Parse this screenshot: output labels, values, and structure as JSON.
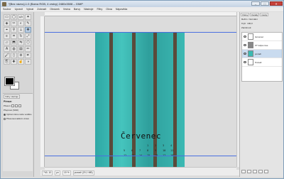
{
  "window": {
    "title": "*[Bez názvu]-1.0 (Barva RGB, 4 vrstvy) 2480x3508 – GIMP",
    "buttons": {
      "minimize": "–",
      "maximize": "□",
      "close": "✕"
    }
  },
  "menubar": [
    "Soubor",
    "Upravit",
    "Vybrat",
    "Zobrazit",
    "Obrázek",
    "Vrstva",
    "Barvy",
    "Nástroje",
    "Filtry",
    "Okna",
    "Nápověda"
  ],
  "toolbox": {
    "tools": [
      "rect-select-icon",
      "ellipse-select-icon",
      "lasso-icon",
      "fuzzy-select-icon",
      "color-select-icon",
      "scissors-icon",
      "foreground-select-icon",
      "paths-icon",
      "color-picker-icon",
      "zoom-icon",
      "measure-icon",
      "move-icon",
      "align-icon",
      "crop-icon",
      "rotate-icon",
      "scale-icon",
      "shear-icon",
      "perspective-icon",
      "flip-icon",
      "cage-icon",
      "text-icon",
      "bucket-fill-icon",
      "blend-icon",
      "pencil-icon",
      "paintbrush-icon",
      "eraser-icon",
      "airbrush-icon",
      "ink-icon",
      "clone-icon",
      "heal-icon",
      "smudge-icon",
      "dodge-icon"
    ],
    "active_tool_index": 11,
    "colors": {
      "foreground": "#000000",
      "background": "#ffffff"
    }
  },
  "tool_options": {
    "tabs": [
      "Volby nástroje"
    ],
    "title": "Přesun",
    "move_label": "Přesun:",
    "toggle_label": "Přepnout (Shift)",
    "options": [
      "Vybrat vrstvu nebo vodítko",
      "Přesunout aktivní vrstvu"
    ],
    "selected_option": 0
  },
  "canvas": {
    "month": "Červenec",
    "calendar_rows": [
      [
        "",
        "",
        "",
        "1",
        "2",
        "3",
        "4"
      ],
      [
        "5",
        "6",
        "7",
        "8",
        "9",
        "10",
        "11"
      ],
      [
        "12",
        "13",
        "14",
        "15",
        "16",
        "17",
        "18"
      ]
    ],
    "colors": {
      "wood_dark": "#5a4a3a",
      "teal": "#2ea8a5",
      "guide": "#4a6fe0"
    }
  },
  "statusbar": {
    "coords": "740, 10",
    "unit": "px",
    "zoom": "15 %",
    "info": "pozadí (20,1 MB)"
  },
  "dock": {
    "tabs": [
      "Vrstvy",
      "Kanály",
      "Cesty"
    ],
    "mode_label": "Režim",
    "mode_value": "Normální",
    "opacity_label": "Krytí",
    "opacity_value": "100,0",
    "lock_label": "Zamknout:",
    "layers": [
      {
        "name": "červenec",
        "active": false
      },
      {
        "name": "KT tulipa rose",
        "active": false
      },
      {
        "name": "pozadí",
        "active": true
      },
      {
        "name": "Pozadí",
        "active": false
      }
    ]
  }
}
